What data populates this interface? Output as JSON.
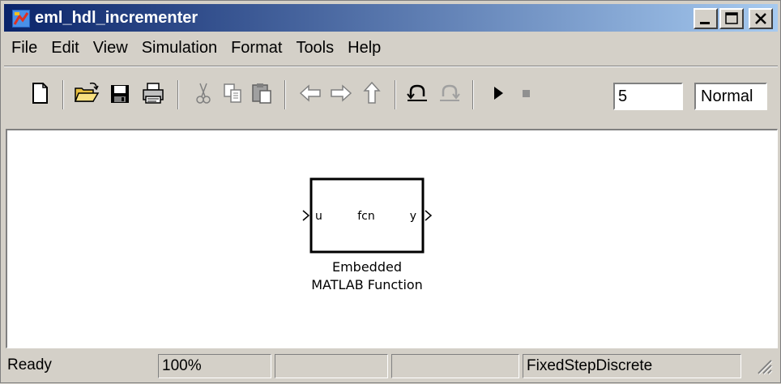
{
  "window": {
    "title": "eml_hdl_incrementer",
    "icon": "simulink-model-icon",
    "controls": [
      "minimize-icon",
      "maximize-icon",
      "close-icon"
    ]
  },
  "menubar": {
    "items": [
      "File",
      "Edit",
      "View",
      "Simulation",
      "Format",
      "Tools",
      "Help"
    ]
  },
  "toolbar": {
    "icons": [
      "new-model-icon",
      "open-icon",
      "save-icon",
      "print-icon",
      "cut-icon",
      "copy-icon",
      "paste-icon",
      "back-icon",
      "forward-icon",
      "up-icon",
      "undo-icon",
      "redo-icon",
      "start-simulation-icon",
      "stop-simulation-icon"
    ],
    "stop_time": "5",
    "sim_mode": "Normal"
  },
  "block": {
    "input_port": "u",
    "function_name": "fcn",
    "output_port": "y",
    "name_line1": "Embedded",
    "name_line2": "MATLAB Function"
  },
  "statusbar": {
    "status": "Ready",
    "zoom": "100%",
    "field3": "",
    "field4": "",
    "solver": "FixedStepDiscrete"
  }
}
